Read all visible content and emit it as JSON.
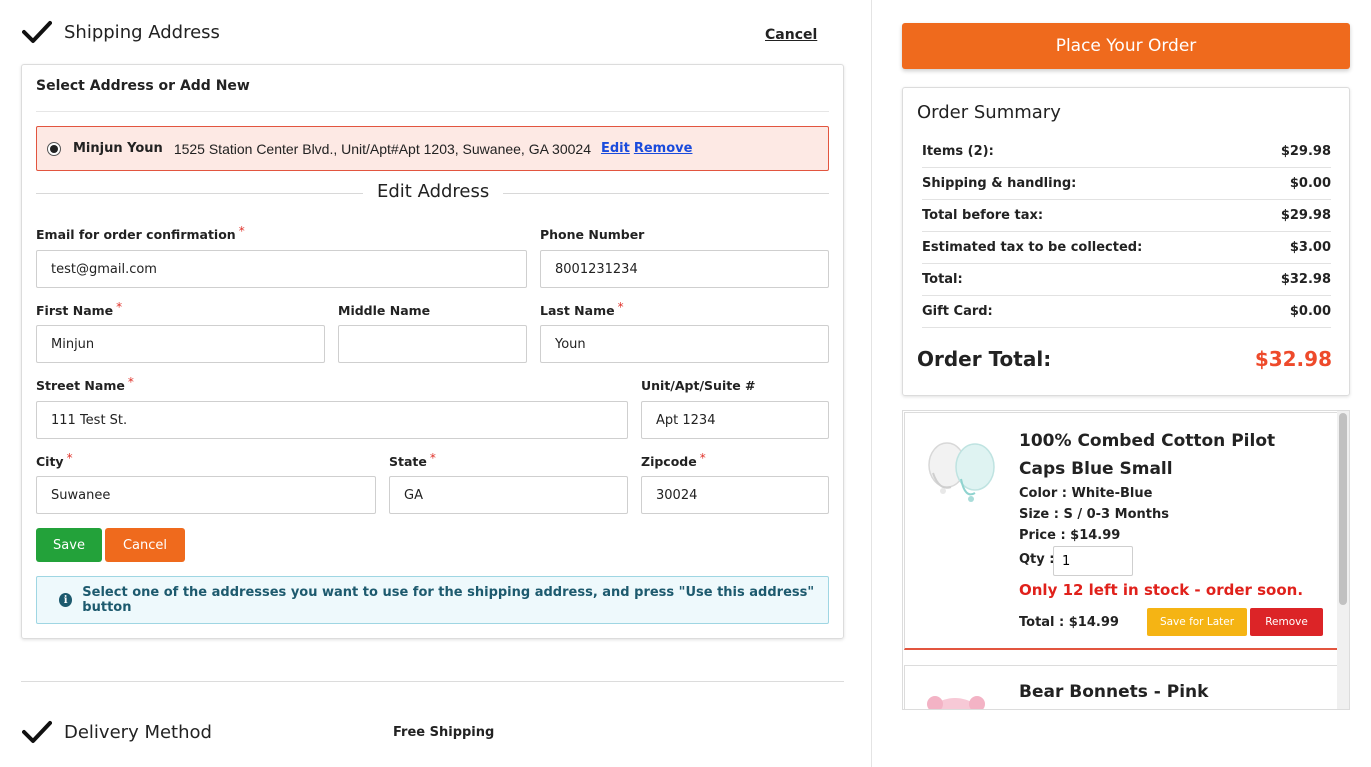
{
  "shipping": {
    "title": "Shipping Address",
    "cancel": "Cancel",
    "select_label": "Select Address or Add New",
    "saved_address": {
      "name": "Minjun Youn",
      "address": "1525 Station Center Blvd., Unit/Apt#Apt 1203, Suwanee, GA 30024",
      "edit": "Edit",
      "remove": "Remove"
    },
    "edit_title": "Edit Address",
    "form": {
      "email_label": "Email for order confirmation",
      "email": "test@gmail.com",
      "phone_label": "Phone Number",
      "phone": "8001231234",
      "first_label": "First Name",
      "first": "Minjun",
      "middle_label": "Middle Name",
      "middle": "",
      "last_label": "Last Name",
      "last": "Youn",
      "street_label": "Street Name",
      "street": "111 Test St.",
      "unit_label": "Unit/Apt/Suite #",
      "unit": "Apt 1234",
      "city_label": "City",
      "city": "Suwanee",
      "state_label": "State",
      "state": "GA",
      "zip_label": "Zipcode",
      "zip": "30024",
      "required_mark": "*"
    },
    "save": "Save",
    "cancel_button": "Cancel",
    "info": "Select one of the addresses you want to use for the shipping address, and press \"Use this address\" button"
  },
  "delivery": {
    "title": "Delivery Method",
    "value": "Free Shipping"
  },
  "place_order": "Place Your Order",
  "summary": {
    "title": "Order Summary",
    "rows": [
      {
        "label": "Items (2):",
        "value": "$29.98"
      },
      {
        "label": "Shipping & handling:",
        "value": "$0.00"
      },
      {
        "label": "Total before tax:",
        "value": "$29.98"
      },
      {
        "label": "Estimated tax to be collected:",
        "value": "$3.00"
      },
      {
        "label": "Total:",
        "value": "$32.98"
      },
      {
        "label": "Gift Card:",
        "value": "$0.00"
      }
    ],
    "order_total_label": "Order Total:",
    "order_total": "$32.98",
    "accent_color": "#ee4a2b"
  },
  "cart": {
    "items": [
      {
        "name": "100% Combed Cotton Pilot Caps Blue Small",
        "color": "Color : White-Blue",
        "size": "Size : S / 0-3 Months",
        "price": "Price : $14.99",
        "qty_label": "Qty :",
        "qty": "1",
        "stock": "Only 12 left in stock - order soon.",
        "total": "Total : $14.99",
        "save_later": "Save for Later",
        "remove": "Remove"
      },
      {
        "name": "Bear Bonnets - Pink"
      }
    ]
  },
  "colors": {
    "orange": "#ef6a1d",
    "green": "#23a23a",
    "red": "#dc2427",
    "yellow": "#f5b414",
    "link_blue": "#1a4bdc"
  }
}
